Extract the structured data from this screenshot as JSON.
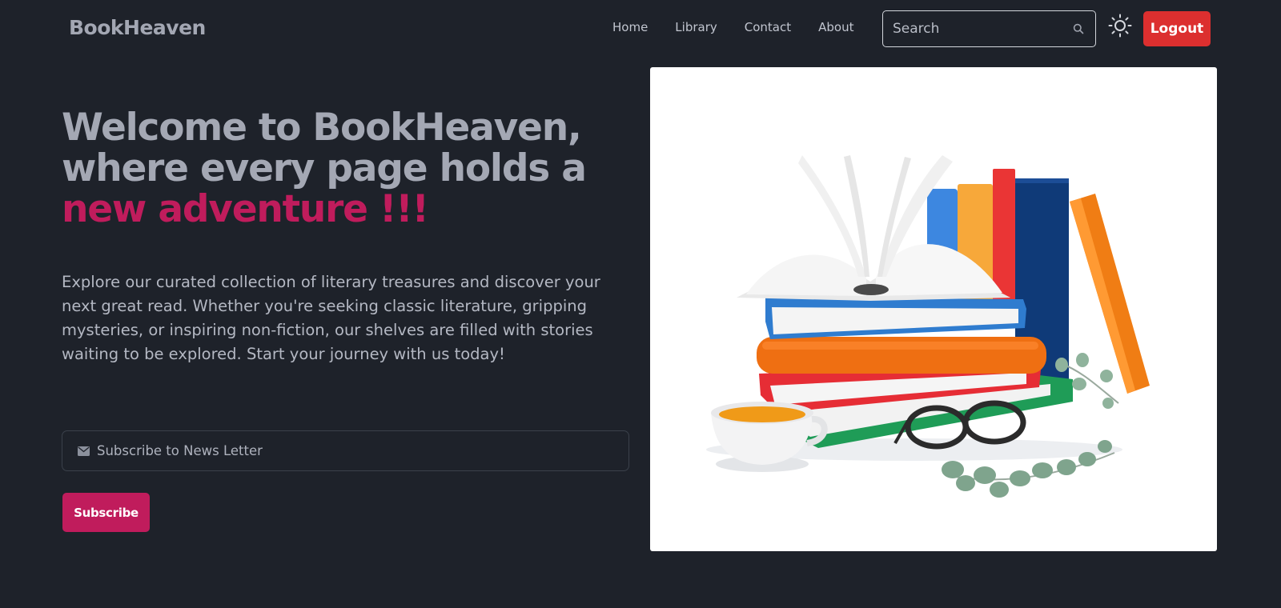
{
  "brand": {
    "name": "BookHeaven"
  },
  "nav": {
    "links": [
      "Home",
      "Library",
      "Contact",
      "About"
    ],
    "search_placeholder": "Search",
    "theme_icon": "sun-icon",
    "logout_label": "Logout"
  },
  "hero": {
    "title_line1": "Welcome to BookHeaven,",
    "title_line2": "where every page holds a",
    "title_accent": "new adventure !!!",
    "description": "Explore our curated collection of literary treasures and discover your next great read. Whether you're seeking classic literature, gripping mysteries, or inspiring non-fiction, our shelves are filled with stories waiting to be explored. Start your journey with us today!",
    "newsletter_placeholder": "Subscribe to News Letter",
    "subscribe_label": "Subscribe"
  },
  "colors": {
    "background": "#1e222a",
    "accent": "#c01c5c",
    "logout": "#dc2f2f",
    "text": "#a4a8b4"
  }
}
